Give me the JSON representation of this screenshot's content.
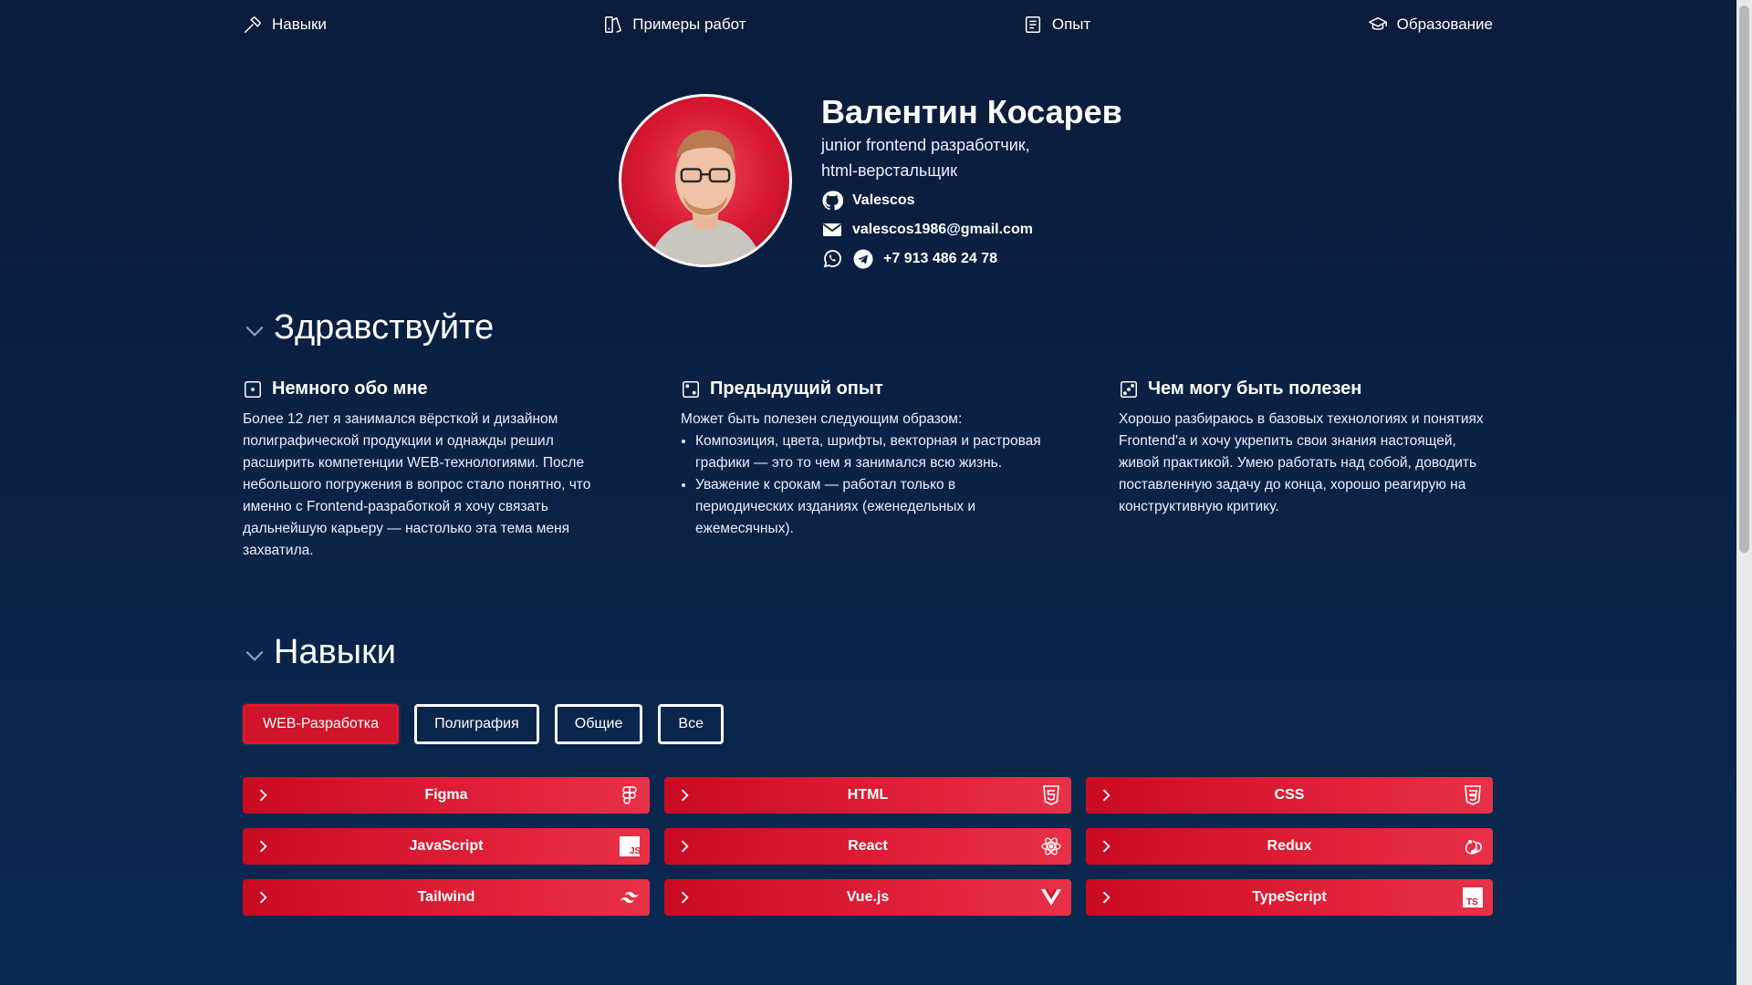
{
  "nav": {
    "skills": "Навыки",
    "portfolio": "Примеры работ",
    "experience": "Опыт",
    "education": "Образование"
  },
  "hero": {
    "name": "Валентин Косарев",
    "role_line1": "junior frontend разработчик,",
    "role_line2": "html-верстальщик",
    "github": "Valescos",
    "email": "valescos1986@gmail.com",
    "phone": "+7 913 486 24 78"
  },
  "hello": {
    "title": "Здравствуйте",
    "col1": {
      "title": "Немного обо мне",
      "text": "Более 12 лет я занимался вёрсткой и дизайном полиграфической продукции и однажды решил расширить компетенции WEB-технологиями. После небольшого погружения в вопрос стало понятно, что именно с Frontend-разработкой я хочу связать дальнейшую карьеру — настолько эта тема меня захватила."
    },
    "col2": {
      "title": "Предыдущий опыт",
      "intro": "Может быть полезен следующим образом:",
      "items": [
        "Композиция, цвета, шрифты, векторная и растровая графики — это то чем я занимался всю жизнь.",
        "Уважение к срокам — работал только в периодических изданиях (еженедельных и ежемесячных)."
      ]
    },
    "col3": {
      "title": "Чем могу быть полезен",
      "text": "Хорошо разбираюсь в базовых технологиях и понятиях Frontend'а и хочу укрепить свои знания настоящей, живой практикой. Умею работать над собой, доводить поставленную задачу до конца, хорошо реагирую на конструктивную критику."
    }
  },
  "skills": {
    "title": "Навыки",
    "tabs": [
      "WEB-Разработка",
      "Полиграфия",
      "Общие",
      "Все"
    ],
    "active_tab": "WEB-Разработка",
    "items": [
      {
        "label": "Figma",
        "icon": "figma-icon"
      },
      {
        "label": "HTML",
        "icon": "html5-icon"
      },
      {
        "label": "CSS",
        "icon": "css3-icon"
      },
      {
        "label": "JavaScript",
        "icon": "javascript-icon"
      },
      {
        "label": "React",
        "icon": "react-icon"
      },
      {
        "label": "Redux",
        "icon": "redux-icon"
      },
      {
        "label": "Tailwind",
        "icon": "tailwind-icon"
      },
      {
        "label": "Vue.js",
        "icon": "vue-icon"
      },
      {
        "label": "TypeScript",
        "icon": "typescript-icon"
      }
    ]
  },
  "colors": {
    "background": "#0b1c3c",
    "accent": "#d0142a",
    "text": "#ffffff"
  }
}
